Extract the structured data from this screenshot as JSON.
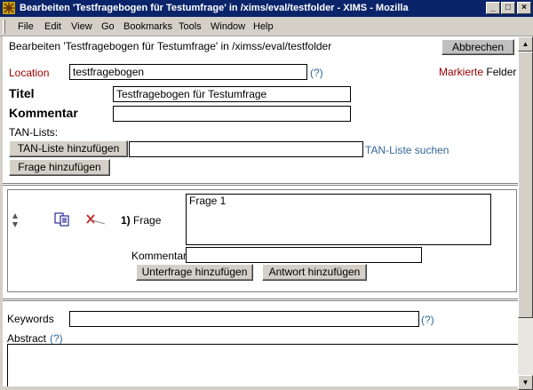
{
  "window": {
    "title": "Bearbeiten  'Testfragebogen für Testumfrage' in /xims/eval/testfolder - XIMS - Mozilla",
    "minimize": "_",
    "maximize": "□",
    "close": "×"
  },
  "menu": [
    "File",
    "Edit",
    "View",
    "Go",
    "Bookmarks",
    "Tools",
    "Window",
    "Help"
  ],
  "header": {
    "breadcrumb": "Bearbeiten  'Testfragebogen für Testumfrage' in /ximss/eval/testfolder",
    "cancel_label": "Abbrechen"
  },
  "form": {
    "location_label": "Location",
    "location_value": "testfragebogen",
    "help_mark": "(?)",
    "marked_fields_label": "Markierte",
    "marked_fields_suffix": "Felder",
    "title_label": "Titel",
    "title_value": "Testfragebogen für Testumfrage",
    "comment_label": "Kommentar",
    "comment_value": "",
    "tan_lists_label": "TAN-Lists:",
    "add_tan_list_label": "TAN-Liste hinzufügen",
    "tan_list_value": "",
    "search_tan_list_label": "TAN-Liste suchen",
    "add_question_label": "Frage hinzufügen"
  },
  "question": {
    "number": "1)",
    "label": "Frage",
    "text": "Frage 1",
    "comment_label": "Kommentar",
    "comment_value": "",
    "add_subquestion_label": "Unterfrage hinzufügen",
    "add_answer_label": "Antwort hinzufügen"
  },
  "meta": {
    "keywords_label": "Keywords",
    "keywords_value": "",
    "abstract_label": "Abstract",
    "abstract_help": "(?)"
  },
  "colors": {
    "titlebar": "#0a246a",
    "link": "#336699",
    "location_label": "#990000"
  }
}
